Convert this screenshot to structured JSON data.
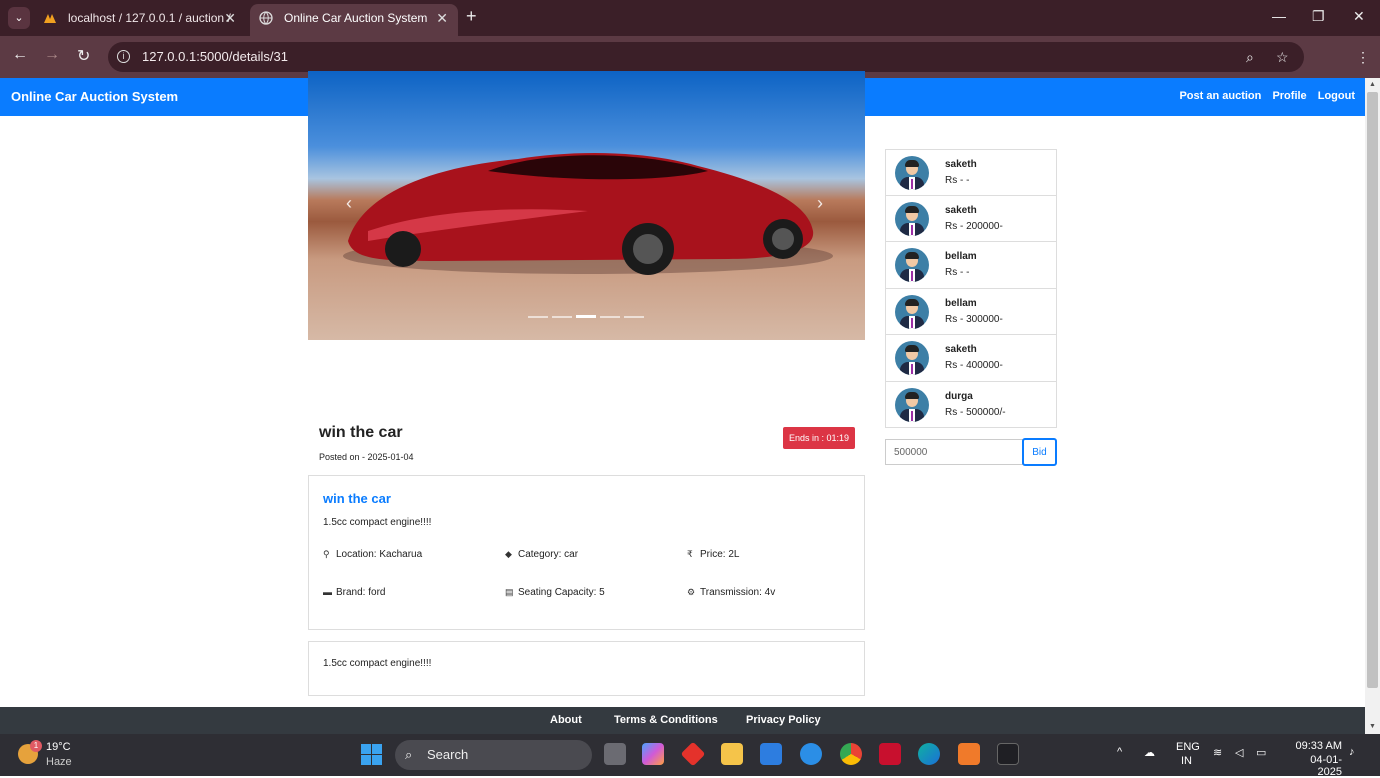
{
  "browser": {
    "tabs": [
      {
        "title": "localhost / 127.0.0.1 / auction /"
      },
      {
        "title": "Online Car Auction System"
      }
    ],
    "url": "127.0.0.1:5000/details/31"
  },
  "navbar": {
    "brand": "Online Car Auction System",
    "links": [
      "Post an auction",
      "Profile",
      "Logout"
    ]
  },
  "listing": {
    "title": "win the car",
    "posted": "Posted on - 2025-01-04",
    "ends_in": "Ends in : 01:19",
    "card_title": "win the car",
    "description": "1.5cc compact engine!!!!",
    "attributes": {
      "location": "Location: Kacharua",
      "category": "Category: car",
      "price": "Price: 2L",
      "brand": "Brand: ford",
      "seating": "Seating Capacity: 5",
      "transmission": "Transmission: 4v"
    },
    "footer_description": "1.5cc compact engine!!!!"
  },
  "bids": [
    {
      "name": "saketh",
      "amount": "Rs - -"
    },
    {
      "name": "saketh",
      "amount": "Rs - 200000-"
    },
    {
      "name": "bellam",
      "amount": "Rs - -"
    },
    {
      "name": "bellam",
      "amount": "Rs - 300000-"
    },
    {
      "name": "saketh",
      "amount": "Rs - 400000-"
    },
    {
      "name": "durga",
      "amount": "Rs - 500000/-"
    }
  ],
  "bid_form": {
    "value": "500000",
    "button": "Bid"
  },
  "footer": {
    "links": [
      "About",
      "Terms & Conditions",
      "Privacy Policy"
    ]
  },
  "taskbar": {
    "temperature": "19°C",
    "weather": "Haze",
    "notification_count": "1",
    "search": "Search",
    "lang": "ENG",
    "region": "IN",
    "time": "09:33 AM",
    "date": "04-01-2025"
  },
  "colors": {
    "navbar": "#0a7cff",
    "ends_badge": "#dc3545",
    "footer": "#343a40"
  }
}
